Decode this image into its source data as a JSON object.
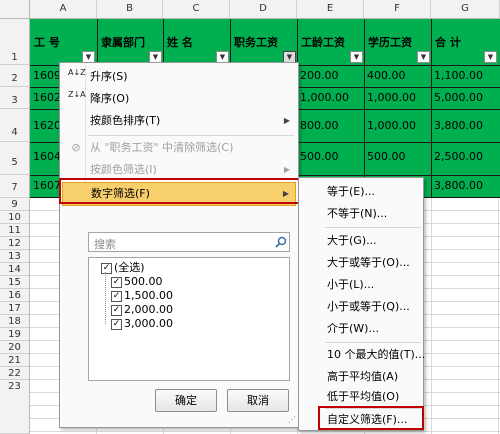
{
  "columns": [
    "A",
    "B",
    "C",
    "D",
    "E",
    "F",
    "G"
  ],
  "rows": [
    "1",
    "2",
    "3",
    "4",
    "5",
    "7",
    "9",
    "10",
    "11",
    "12",
    "13",
    "14",
    "15",
    "16",
    "17",
    "18",
    "19",
    "20",
    "21",
    "22",
    "23"
  ],
  "headers": {
    "a": "工  号",
    "b": "隶属部门",
    "c": "姓  名",
    "d": "职务工资",
    "e": "工龄工资",
    "f": "学历工资",
    "g": "合  计"
  },
  "filter_arrow": "▼",
  "filter_active_icon": "▼",
  "data_rows": [
    {
      "id": "1609",
      "e": "200.00",
      "f": "400.00",
      "g": "1,100.00"
    },
    {
      "id": "1602",
      "e": "1,000.00",
      "f": "1,000.00",
      "g": "5,000.00"
    },
    {
      "id": "1620",
      "e": "800.00",
      "f": "1,000.00",
      "g": "3,800.00"
    },
    {
      "id": "1604",
      "e": "500.00",
      "f": "500.00",
      "g": "2,500.00"
    },
    {
      "id": "1607",
      "e": "",
      "f": "",
      "g": "3,800.00"
    }
  ],
  "menu": {
    "sort_asc": "升序(S)",
    "sort_desc": "降序(O)",
    "sort_color": "按颜色排序(T)",
    "clear_filter": "从 \"职务工资\" 中清除筛选(C)",
    "filter_color": "按颜色筛选(I)",
    "number_filter": "数字筛选(F)",
    "search_placeholder": "搜索",
    "select_all": "(全选)",
    "values": [
      "500.00",
      "1,500.00",
      "2,000.00",
      "3,000.00"
    ],
    "ok": "确定",
    "cancel": "取消",
    "submenu_arrow": "▶",
    "sort_asc_icon": "A↓Z",
    "sort_desc_icon": "Z↓A",
    "check": "✓"
  },
  "submenu": [
    "等于(E)...",
    "不等于(N)...",
    "大于(G)...",
    "大于或等于(O)...",
    "小于(L)...",
    "小于或等于(Q)...",
    "介于(W)...",
    "10 个最大的值(T)...",
    "高于平均值(A)",
    "低于平均值(O)",
    "自定义筛选(F)..."
  ],
  "colors": {
    "header_fill": "#00b050",
    "highlight": "#f7cf6b",
    "callout": "#c00000"
  }
}
